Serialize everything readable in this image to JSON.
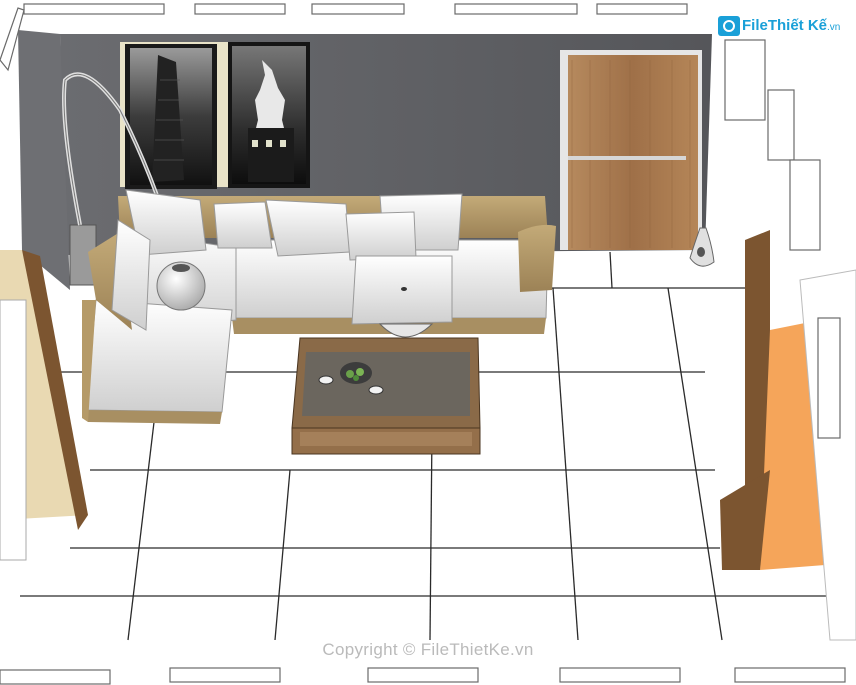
{
  "watermark": {
    "logo_main": "FileThiết Kế",
    "logo_suffix": ".vn",
    "copyright": "Copyright © FileThietKe.vn"
  },
  "colors": {
    "wall": "#5b5c60",
    "floor": "#ffffff",
    "floor_grid": "#2a2a2a",
    "door_wood": "#a9794f",
    "sofa_fabric": "#b59a68",
    "sofa_cushion": "#eeeeee",
    "table_wood": "#8a6a48",
    "accent_wall": "#f5a55a",
    "brand": "#1aa0d8"
  }
}
